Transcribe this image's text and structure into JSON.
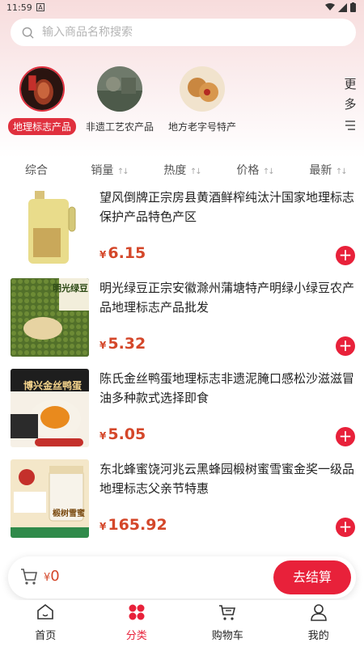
{
  "status": {
    "time": "11:59",
    "a_badge": "A"
  },
  "search": {
    "placeholder": "输入商品名称搜索"
  },
  "categories": [
    {
      "label": "地理标志产品",
      "active": true
    },
    {
      "label": "非遗工艺农产品",
      "active": false
    },
    {
      "label": "地方老字号特产",
      "active": false
    }
  ],
  "more_label": "更多",
  "sort": [
    "综合",
    "销量",
    "热度",
    "价格",
    "最新"
  ],
  "products": [
    {
      "title": "望风倒牌正宗房县黄酒鲜榨纯汰汁国家地理标志保护产品特色产区",
      "currency": "¥",
      "price": "6.15",
      "thumb_text": ""
    },
    {
      "title": "明光绿豆正宗安徽滁州蒲塘特产明绿小绿豆农产品地理标志产品批发",
      "currency": "¥",
      "price": "5.32",
      "thumb_text": "明光绿豆"
    },
    {
      "title": "陈氏金丝鸭蛋地理标志非遗泥腌口感松沙滋滋冒油多种款式选择即食",
      "currency": "¥",
      "price": "5.05",
      "thumb_text": "博兴金丝鸭蛋"
    },
    {
      "title": "东北蜂蜜饶河兆云黑蜂园椴树蜜雪蜜金奖一级品地理标志父亲节特惠",
      "currency": "¥",
      "price": "165.92",
      "thumb_text": "椴树雪蜜"
    }
  ],
  "cart": {
    "currency": "¥",
    "total": "0",
    "checkout_label": "去结算"
  },
  "tabs": [
    {
      "label": "首页",
      "icon": "home-icon",
      "active": false
    },
    {
      "label": "分类",
      "icon": "category-icon",
      "active": true
    },
    {
      "label": "购物车",
      "icon": "cart-icon",
      "active": false
    },
    {
      "label": "我的",
      "icon": "user-icon",
      "active": false
    }
  ],
  "colors": {
    "accent": "#e8213a",
    "price": "#d4472a",
    "header_bg": "#f7dcdc"
  }
}
